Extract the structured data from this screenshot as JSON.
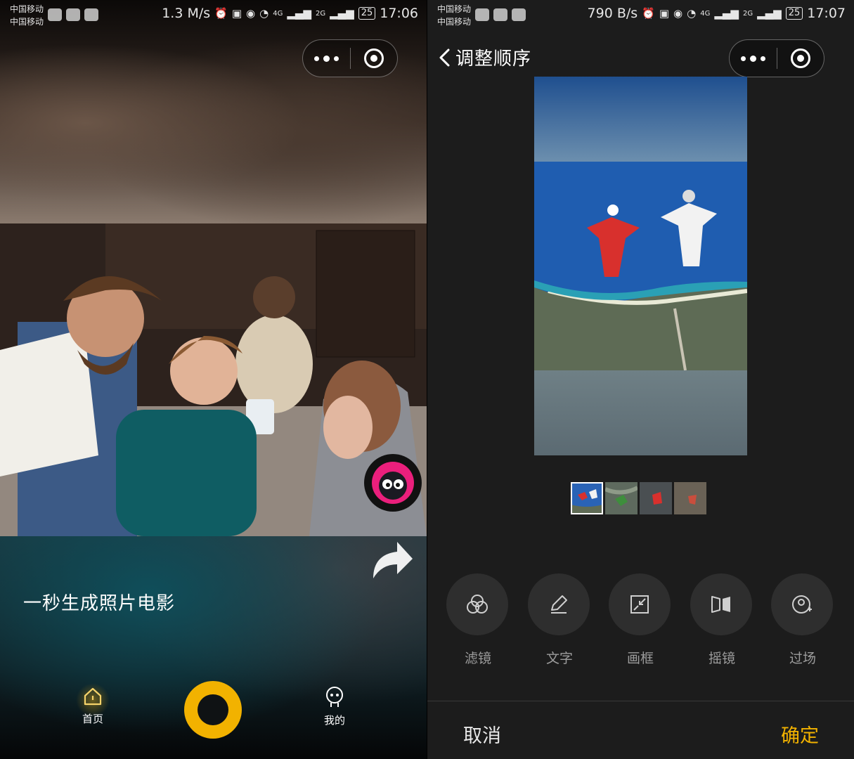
{
  "left": {
    "status": {
      "carrier1": "中国移动",
      "carrier2": "中国移动",
      "speed": "1.3 M/s",
      "network1": "4G",
      "network2": "2G",
      "battery": "25",
      "time": "17:06"
    },
    "tagline": "一秒生成照片电影",
    "nav": {
      "home_label": "首页",
      "mine_label": "我的"
    }
  },
  "right": {
    "status": {
      "carrier1": "中国移动",
      "carrier2": "中国移动",
      "speed": "790 B/s",
      "network1": "4G",
      "network2": "2G",
      "battery": "25",
      "time": "17:07"
    },
    "title": "调整顺序",
    "tools": [
      {
        "label": "滤镜",
        "icon": "filter-icon"
      },
      {
        "label": "文字",
        "icon": "pencil-icon"
      },
      {
        "label": "画框",
        "icon": "frame-icon"
      },
      {
        "label": "摇镜",
        "icon": "pan-icon"
      },
      {
        "label": "过场",
        "icon": "transition-icon"
      }
    ],
    "cancel_label": "取消",
    "confirm_label": "确定",
    "thumbnail_count": 4,
    "selected_thumbnail": 1
  },
  "colors": {
    "accent": "#f2b200",
    "panel_bg": "#1c1c1c",
    "tool_bg": "#2e2e2e",
    "tool_label": "#9c9c9c"
  }
}
